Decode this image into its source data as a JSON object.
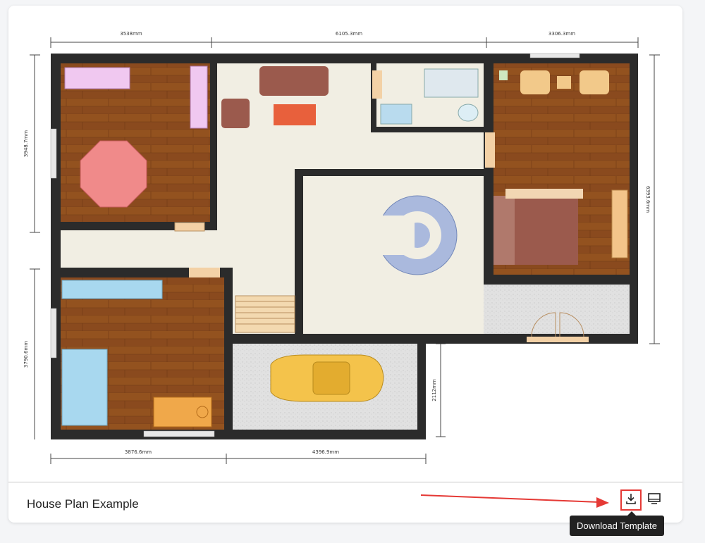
{
  "card": {
    "title": "House Plan Example"
  },
  "dimensions": {
    "top_1": "3538mm",
    "top_2": "6105.3mm",
    "top_3": "3306.3mm",
    "left_top": "3948.7mm",
    "left_bottom": "3790.6mm",
    "right": "6393.6mm",
    "garage": "2112mm",
    "bottom_1": "3876.6mm",
    "bottom_2": "4396.9mm"
  },
  "actions": {
    "download_icon": "download-icon",
    "present_icon": "monitor-icon",
    "tooltip": "Download Template"
  },
  "colors": {
    "wall": "#2b2b2b",
    "wood": "#8a4a1e",
    "floor": "#f1eee3",
    "garage": "#e4e4e4",
    "annotation": "#e53935"
  }
}
